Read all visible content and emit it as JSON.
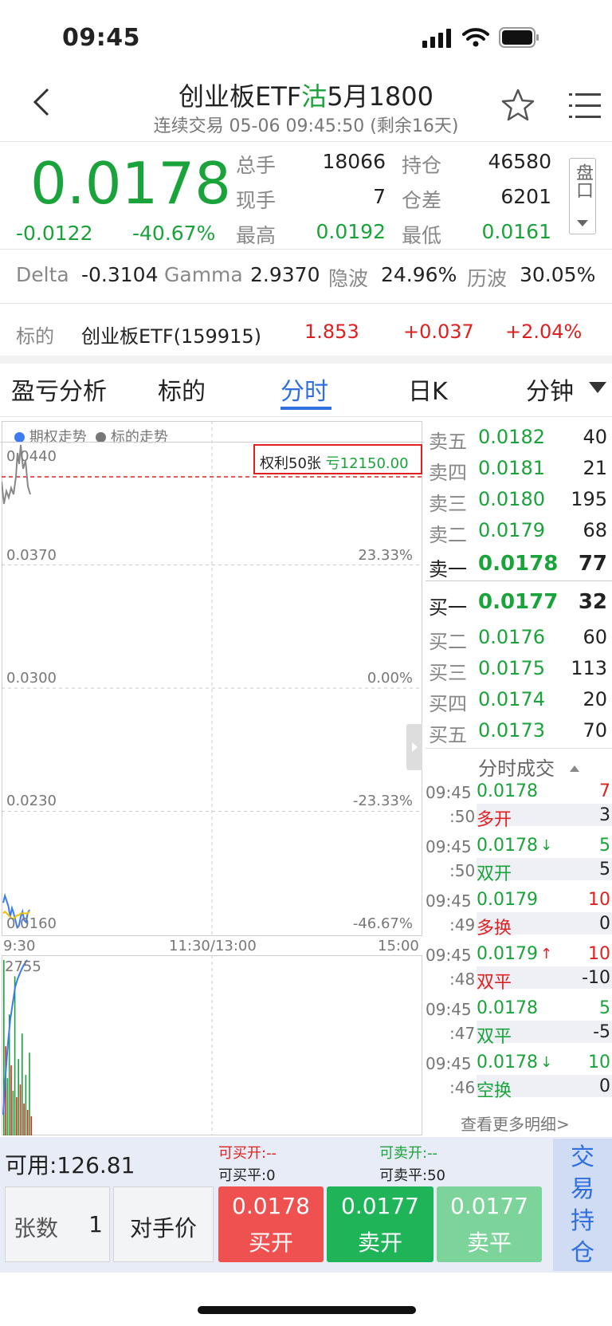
{
  "status_bar": {
    "time": "09:45"
  },
  "header": {
    "title_prefix": "创业板ETF",
    "title_type": "沽",
    "title_suffix": "5月1800",
    "subtitle": "连续交易 05-06 09:45:50 (剩余16天)"
  },
  "quote": {
    "price": "0.0178",
    "change": "-0.0122",
    "change_pct": "-40.67%",
    "total_vol_label": "总手",
    "total_vol": "18066",
    "position_label": "持仓",
    "position": "46580",
    "current_vol_label": "现手",
    "current_vol": "7",
    "pos_diff_label": "仓差",
    "pos_diff": "6201",
    "high_label": "最高",
    "high": "0.0192",
    "low_label": "最低",
    "low": "0.0161",
    "pankou_label": "盘口"
  },
  "greeks": {
    "delta_label": "Delta",
    "delta": "-0.3104",
    "gamma_label": "Gamma",
    "gamma": "2.9370",
    "iv_label": "隐波",
    "iv": "24.96%",
    "hv_label": "历波",
    "hv": "30.05%"
  },
  "underlying": {
    "label": "标的",
    "name": "创业板ETF(159915)",
    "price": "1.853",
    "change": "+0.037",
    "change_pct": "+2.04%"
  },
  "tabs": [
    "盈亏分析",
    "标的",
    "分时",
    "日K",
    "分钟"
  ],
  "active_tab": "分时",
  "chart": {
    "legend_option": "期权走势",
    "legend_underlying": "标的走势",
    "position_box": "权利50张",
    "position_pnl": "亏12150.00",
    "y_labels": [
      "0.0440",
      "0.0370",
      "0.0300",
      "0.0230",
      "0.0160"
    ],
    "pct_labels": [
      "23.33%",
      "0.00%",
      "-23.33%",
      "-46.67%"
    ],
    "x_labels": [
      "9:30",
      "11:30/13:00",
      "15:00"
    ],
    "volume_max": "2755",
    "colors": {
      "option_line": "#3d7cf0",
      "underlying_line": "#888888",
      "avg_line": "#f2c200",
      "up": "#e0201f",
      "down": "#1aa33a"
    }
  },
  "order_book": {
    "asks": [
      {
        "label": "卖五",
        "price": "0.0182",
        "vol": "40"
      },
      {
        "label": "卖四",
        "price": "0.0181",
        "vol": "21"
      },
      {
        "label": "卖三",
        "price": "0.0180",
        "vol": "195"
      },
      {
        "label": "卖二",
        "price": "0.0179",
        "vol": "68"
      },
      {
        "label": "卖一",
        "price": "0.0178",
        "vol": "77"
      }
    ],
    "bids": [
      {
        "label": "买一",
        "price": "0.0177",
        "vol": "32"
      },
      {
        "label": "买二",
        "price": "0.0176",
        "vol": "60"
      },
      {
        "label": "买三",
        "price": "0.0175",
        "vol": "113"
      },
      {
        "label": "买四",
        "price": "0.0174",
        "vol": "20"
      },
      {
        "label": "买五",
        "price": "0.0173",
        "vol": "70"
      }
    ]
  },
  "trades": {
    "title": "分时成交",
    "items": [
      {
        "time1": "09:45",
        "time2": ":50",
        "price": "0.0178",
        "arrow": "",
        "vol": "7",
        "type": "多开",
        "oi": "3"
      },
      {
        "time1": "09:45",
        "time2": ":50",
        "price": "0.0178",
        "arrow": "↓",
        "vol": "5",
        "type": "双开",
        "oi": "5"
      },
      {
        "time1": "09:45",
        "time2": ":49",
        "price": "0.0179",
        "arrow": "",
        "vol": "10",
        "type": "多换",
        "oi": "0"
      },
      {
        "time1": "09:45",
        "time2": ":48",
        "price": "0.0179",
        "arrow": "↑",
        "vol": "10",
        "type": "双平",
        "oi": "-10"
      },
      {
        "time1": "09:45",
        "time2": ":47",
        "price": "0.0178",
        "arrow": "",
        "vol": "5",
        "type": "双平",
        "oi": "-5"
      },
      {
        "time1": "09:45",
        "time2": ":46",
        "price": "0.0178",
        "arrow": "↓",
        "vol": "10",
        "type": "空换",
        "oi": "0"
      }
    ],
    "more": "查看更多明细>"
  },
  "bottom": {
    "available": "可用:126.81",
    "can_buy_open": "可买开:--",
    "can_buy_close": "可买平:0",
    "can_sell_open": "可卖开:--",
    "can_sell_close": "可卖平:50",
    "qty_label": "张数",
    "qty_value": "1",
    "price_mode": "对手价",
    "buy_open_price": "0.0178",
    "buy_open_label": "买开",
    "sell_open_price": "0.0177",
    "sell_open_label": "卖开",
    "sell_close_price": "0.0177",
    "sell_close_label": "卖平",
    "side_label": [
      "交",
      "易",
      "持",
      "仓"
    ]
  }
}
